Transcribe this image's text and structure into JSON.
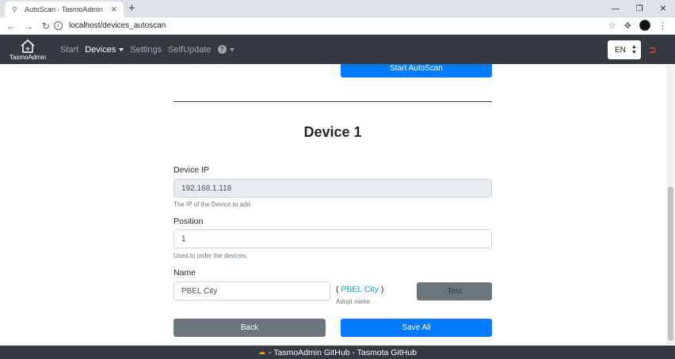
{
  "browser": {
    "tab_title": "AutoScan - TasmoAdmin",
    "url": "localhost/devices_autoscan"
  },
  "navbar": {
    "brand": "TasmoAdmin",
    "links": [
      "Start",
      "Devices",
      "Settings",
      "SelfUpdate"
    ],
    "language": "EN"
  },
  "main": {
    "start_autoscan_label": "Start AutoScan",
    "device_title": "Device 1",
    "device_ip": {
      "label": "Device IP",
      "value": "192.168.1.118",
      "hint": "The IP of the Device to add"
    },
    "position": {
      "label": "Position",
      "value": "1",
      "hint": "Used to order the devices."
    },
    "name": {
      "label": "Name",
      "value": "PBEL City",
      "adopt_open": "(",
      "adopt_link": "PBEL City",
      "adopt_close": ")",
      "adopt_hint": "Adopt name"
    },
    "test_label": "Test",
    "back_label": "Back",
    "save_all_label": "Save All"
  },
  "footer": {
    "text": " - TasmoAdmin GitHub - Tasmota GitHub"
  },
  "colors": {
    "navbar": "#343a40",
    "primary": "#007bff",
    "secondary": "#6c757d",
    "link": "#17a2b8",
    "logout": "#dc3545"
  }
}
